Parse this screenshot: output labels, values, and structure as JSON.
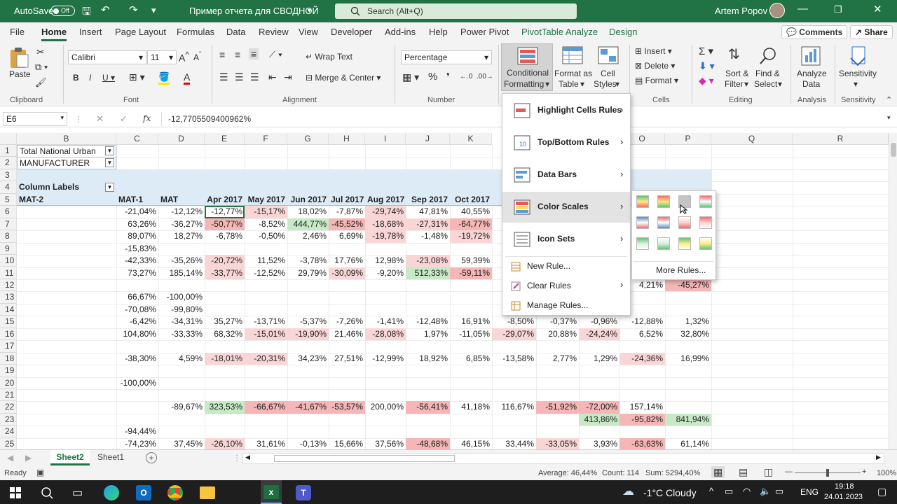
{
  "titlebar": {
    "autosave": "AutoSave",
    "toggle": "Off",
    "doc_title": "Пример отчета для СВОДНОЙ",
    "search_placeholder": "Search (Alt+Q)",
    "user": "Artem Popov"
  },
  "menu": {
    "tabs": [
      "File",
      "Home",
      "Insert",
      "Page Layout",
      "Formulas",
      "Data",
      "Review",
      "View",
      "Developer",
      "Add-ins",
      "Help",
      "Power Pivot",
      "PivotTable Analyze",
      "Design"
    ],
    "comments": "Comments",
    "share": "Share"
  },
  "ribbon": {
    "paste": "Paste",
    "clipboard": "Clipboard",
    "font_name": "Calibri",
    "font_size": "11",
    "font": "Font",
    "alignment": "Alignment",
    "wrap_text": "Wrap Text",
    "merge_center": "Merge & Center",
    "number_format": "Percentage",
    "number": "Number",
    "conditional_formatting": [
      "Conditional",
      "Formatting"
    ],
    "format_as_table": [
      "Format as",
      "Table"
    ],
    "cell_styles": [
      "Cell",
      "Styles"
    ],
    "insert": "Insert",
    "delete": "Delete",
    "format": "Format",
    "cells": "Cells",
    "sort_filter": [
      "Sort &",
      "Filter"
    ],
    "find_select": [
      "Find &",
      "Select"
    ],
    "editing": "Editing",
    "analyze_data": [
      "Analyze",
      "Data"
    ],
    "analysis": "Analysis",
    "sensitivity": "Sensitivity",
    "sensitivity_grp": "Sensitivity"
  },
  "formula_bar": {
    "name_box": "E6",
    "fx": "fx",
    "formula": "-12,7705509400962%"
  },
  "columns": [
    "B",
    "C",
    "D",
    "E",
    "F",
    "G",
    "H",
    "I",
    "J",
    "K",
    "O",
    "P",
    "Q",
    "R"
  ],
  "rows": [
    "1",
    "2",
    "3",
    "4",
    "5",
    "6",
    "7",
    "8",
    "9",
    "10",
    "11",
    "12",
    "13",
    "14",
    "15",
    "16",
    "17",
    "18",
    "19",
    "20",
    "21",
    "22",
    "23",
    "24",
    "25"
  ],
  "cells": {
    "r1": "Total National Urban",
    "r2": "MANUFACTURER",
    "r4": "Column Labels",
    "r5": "MAT-2",
    "hdr": [
      "MAT-1",
      "MAT",
      "Apr 2017",
      "May 2017",
      "Jun 2017",
      "Jul 2017",
      "Aug 2017",
      "Sep 2017",
      "Oct 2017",
      "No"
    ]
  },
  "table": [
    {
      "r": 6,
      "v": [
        "-21,04%",
        "-12,12%",
        "-12,77%",
        "-15,17%",
        "18,02%",
        "-7,87%",
        "-29,74%",
        "47,81%",
        "40,55%"
      ]
    },
    {
      "r": 7,
      "v": [
        "63,26%",
        "-36,27%",
        "-50,77%",
        "-8,52%",
        "444,77%",
        "-45,52%",
        "-18,68%",
        "-27,31%",
        "-64,77%"
      ]
    },
    {
      "r": 8,
      "v": [
        "89,07%",
        "18,27%",
        "-6,78%",
        "-0,50%",
        "2,46%",
        "6,69%",
        "-19,78%",
        "-1,48%",
        "-19,72%"
      ]
    },
    {
      "r": 9,
      "v": [
        "-15,83%",
        "",
        "",
        "",
        "",
        "",
        "",
        "",
        ""
      ]
    },
    {
      "r": 10,
      "v": [
        "-42,33%",
        "-35,26%",
        "-20,72%",
        "11,52%",
        "-3,78%",
        "17,76%",
        "12,98%",
        "-23,08%",
        "59,39%"
      ]
    },
    {
      "r": 11,
      "v": [
        "73,27%",
        "185,14%",
        "-33,77%",
        "-12,52%",
        "29,79%",
        "-30,09%",
        "-9,20%",
        "512,33%",
        "-59,11%"
      ]
    },
    {
      "r": 13,
      "v": [
        "66,67%",
        "-100,00%",
        "",
        "",
        "",
        "",
        "",
        "",
        ""
      ]
    },
    {
      "r": 14,
      "v": [
        "-70,08%",
        "-99,80%",
        "",
        "",
        "",
        "",
        "",
        "",
        ""
      ]
    },
    {
      "r": 15,
      "v": [
        "-6,42%",
        "-34,31%",
        "35,27%",
        "-13,71%",
        "-5,37%",
        "-7,26%",
        "-1,41%",
        "-12,48%",
        "16,91%"
      ]
    },
    {
      "r": 16,
      "v": [
        "104,80%",
        "-33,33%",
        "68,32%",
        "-15,01%",
        "-19,90%",
        "21,46%",
        "-28,08%",
        "1,97%",
        "-11,05%"
      ]
    },
    {
      "r": 18,
      "v": [
        "-38,30%",
        "4,59%",
        "-18,01%",
        "-20,31%",
        "34,23%",
        "27,51%",
        "-12,99%",
        "18,92%",
        "6,85%"
      ]
    },
    {
      "r": 20,
      "v": [
        "-100,00%",
        "",
        "",
        "",
        "",
        "",
        "",
        "",
        ""
      ]
    },
    {
      "r": 22,
      "v": [
        "",
        "-89,67%",
        "323,53%",
        "-66,67%",
        "-41,67%",
        "-53,57%",
        "200,00%",
        "-56,41%",
        "41,18%"
      ]
    },
    {
      "r": 24,
      "v": [
        "-94,44%",
        "",
        "",
        "",
        "",
        "",
        "",
        "",
        ""
      ]
    },
    {
      "r": 25,
      "v": [
        "-74,23%",
        "37,45%",
        "-26,10%",
        "31,61%",
        "-0,13%",
        "15,66%",
        "37,56%",
        "-48,68%",
        "46,15%"
      ]
    }
  ],
  "right_cells": [
    {
      "r": 12,
      "c": "O",
      "v": "4,21%"
    },
    {
      "r": 12,
      "c": "P",
      "v": "-45,27%"
    },
    {
      "r": 15,
      "c": "L",
      "v": "-8,50%"
    },
    {
      "r": 15,
      "c": "M",
      "v": "-0,37%"
    },
    {
      "r": 15,
      "c": "N",
      "v": "-0,96%"
    },
    {
      "r": 15,
      "c": "O",
      "v": "-12,88%"
    },
    {
      "r": 15,
      "c": "P",
      "v": "1,32%"
    },
    {
      "r": 16,
      "c": "L",
      "v": "-29,07%"
    },
    {
      "r": 16,
      "c": "M",
      "v": "20,88%"
    },
    {
      "r": 16,
      "c": "N",
      "v": "-24,24%"
    },
    {
      "r": 16,
      "c": "O",
      "v": "6,52%"
    },
    {
      "r": 16,
      "c": "P",
      "v": "32,80%"
    },
    {
      "r": 18,
      "c": "L",
      "v": "-13,58%"
    },
    {
      "r": 18,
      "c": "M",
      "v": "2,77%"
    },
    {
      "r": 18,
      "c": "N",
      "v": "1,29%"
    },
    {
      "r": 18,
      "c": "O",
      "v": "-24,36%"
    },
    {
      "r": 18,
      "c": "P",
      "v": "16,99%"
    },
    {
      "r": 22,
      "c": "L",
      "v": "116,67%"
    },
    {
      "r": 22,
      "c": "M",
      "v": "-51,92%"
    },
    {
      "r": 22,
      "c": "N",
      "v": "-72,00%"
    },
    {
      "r": 22,
      "c": "O",
      "v": "157,14%"
    },
    {
      "r": 23,
      "c": "N",
      "v": "413,86%"
    },
    {
      "r": 23,
      "c": "O",
      "v": "-95,82%"
    },
    {
      "r": 23,
      "c": "P",
      "v": "841,94%"
    },
    {
      "r": 25,
      "c": "L",
      "v": "33,44%"
    },
    {
      "r": 25,
      "c": "M",
      "v": "-33,05%"
    },
    {
      "r": 25,
      "c": "N",
      "v": "3,93%"
    },
    {
      "r": 25,
      "c": "O",
      "v": "-63,63%"
    },
    {
      "r": 25,
      "c": "P",
      "v": "61,14%"
    }
  ],
  "cf_menu": {
    "items": [
      "Highlight Cells Rules",
      "Top/Bottom Rules",
      "Data Bars",
      "Color Scales",
      "Icon Sets"
    ],
    "new_rule": "New Rule...",
    "clear_rules": "Clear Rules",
    "manage_rules": "Manage Rules...",
    "more_rules": "More Rules..."
  },
  "sheets": [
    "Sheet2",
    "Sheet1"
  ],
  "status": {
    "ready": "Ready",
    "average": "Average: 46,44%",
    "count": "Count: 114",
    "sum": "Sum: 5294,40%",
    "zoom": "100%"
  },
  "taskbar": {
    "weather": "-1°C  Cloudy",
    "lang": "ENG",
    "time": "19:18",
    "date": "24.01.2023"
  }
}
